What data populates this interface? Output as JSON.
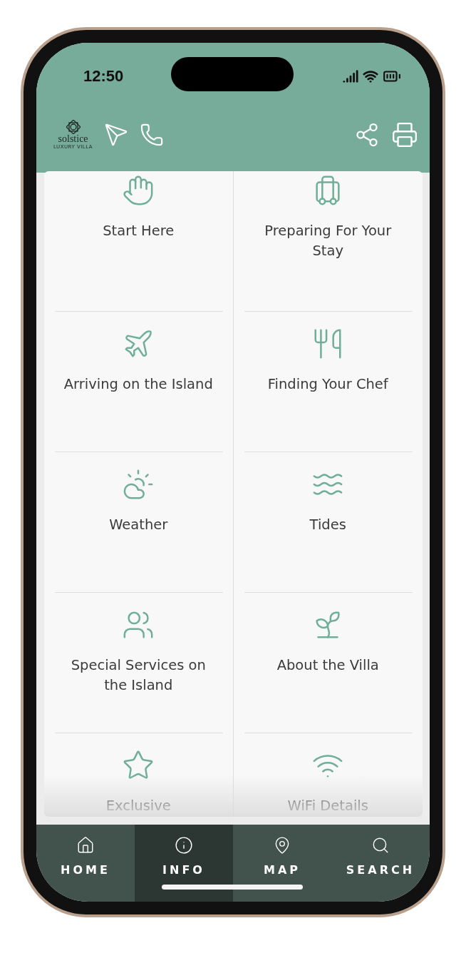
{
  "status_bar": {
    "time": "12:50"
  },
  "header": {
    "logo": {
      "name": "solstice",
      "tagline": "LUXURY VILLA"
    }
  },
  "tiles": [
    {
      "label": "Start Here"
    },
    {
      "label": "Preparing For Your Stay"
    },
    {
      "label": "Arriving on the Island"
    },
    {
      "label": "Finding Your Chef"
    },
    {
      "label": "Weather"
    },
    {
      "label": "Tides"
    },
    {
      "label": "Special Services on the Island"
    },
    {
      "label": "About the Villa"
    },
    {
      "label": "Exclusive"
    },
    {
      "label": "WiFi Details"
    }
  ],
  "nav": [
    {
      "label": "HOME",
      "selected": false
    },
    {
      "label": "INFO",
      "selected": true
    },
    {
      "label": "MAP",
      "selected": false
    },
    {
      "label": "SEARCH",
      "selected": false
    }
  ]
}
